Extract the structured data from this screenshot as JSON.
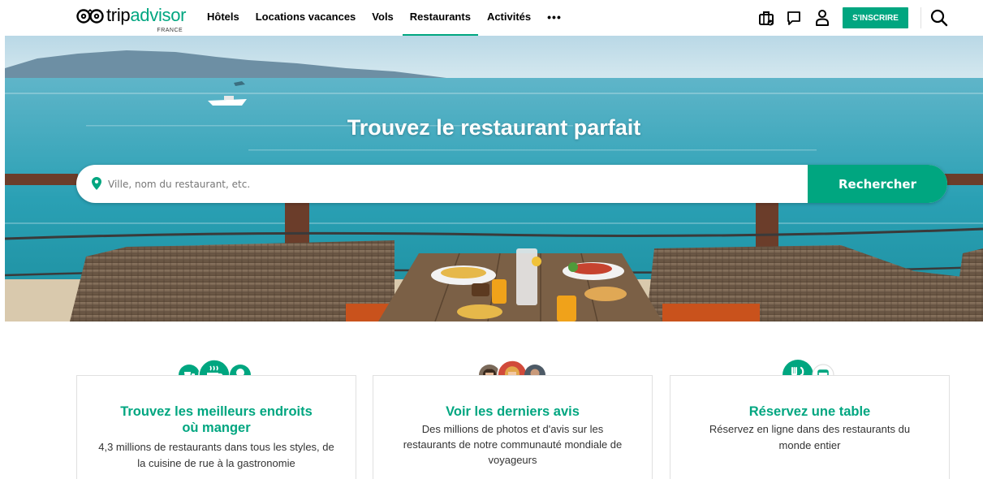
{
  "brand": {
    "name_part1": "trip",
    "name_part2": "advisor",
    "country": "FRANCE",
    "accent": "#00a680"
  },
  "nav": {
    "items": [
      {
        "label": "Hôtels"
      },
      {
        "label": "Locations vacances"
      },
      {
        "label": "Vols"
      },
      {
        "label": "Restaurants",
        "active": true
      },
      {
        "label": "Activités"
      }
    ],
    "more_label": "•••"
  },
  "header": {
    "icons": [
      "suitcase-icon",
      "message-icon",
      "user-icon",
      "search-icon"
    ],
    "signup_label": "S'INSCRIRE"
  },
  "hero": {
    "title": "Trouvez le restaurant parfait",
    "search_placeholder": "Ville, nom du restaurant, etc.",
    "search_button": "Rechercher"
  },
  "cards": [
    {
      "title_line1": "Trouvez les meilleurs endroits",
      "title_line2": "où manger",
      "desc_line1": "4,3 millions de restaurants dans tous les styles, de",
      "desc_line2": "la cuisine de rue à la gastronomie",
      "icons": [
        "takeout-icon",
        "coffee-icon",
        "ice-cream-icon"
      ]
    },
    {
      "title_line1": "Voir les derniers avis",
      "desc_line1": "Des millions de photos et d'avis sur les",
      "desc_line2": "restaurants de notre communauté mondiale de",
      "desc_line3": "voyageurs",
      "icons": [
        "reviewer-avatar",
        "reviewer-avatar",
        "reviewer-avatar"
      ]
    },
    {
      "title_line1": "Réservez une table",
      "desc_line1": "Réservez en ligne dans des restaurants du",
      "desc_line2": "monde entier",
      "icons": [
        "fork-knife-icon",
        "calendar-icon"
      ]
    }
  ]
}
